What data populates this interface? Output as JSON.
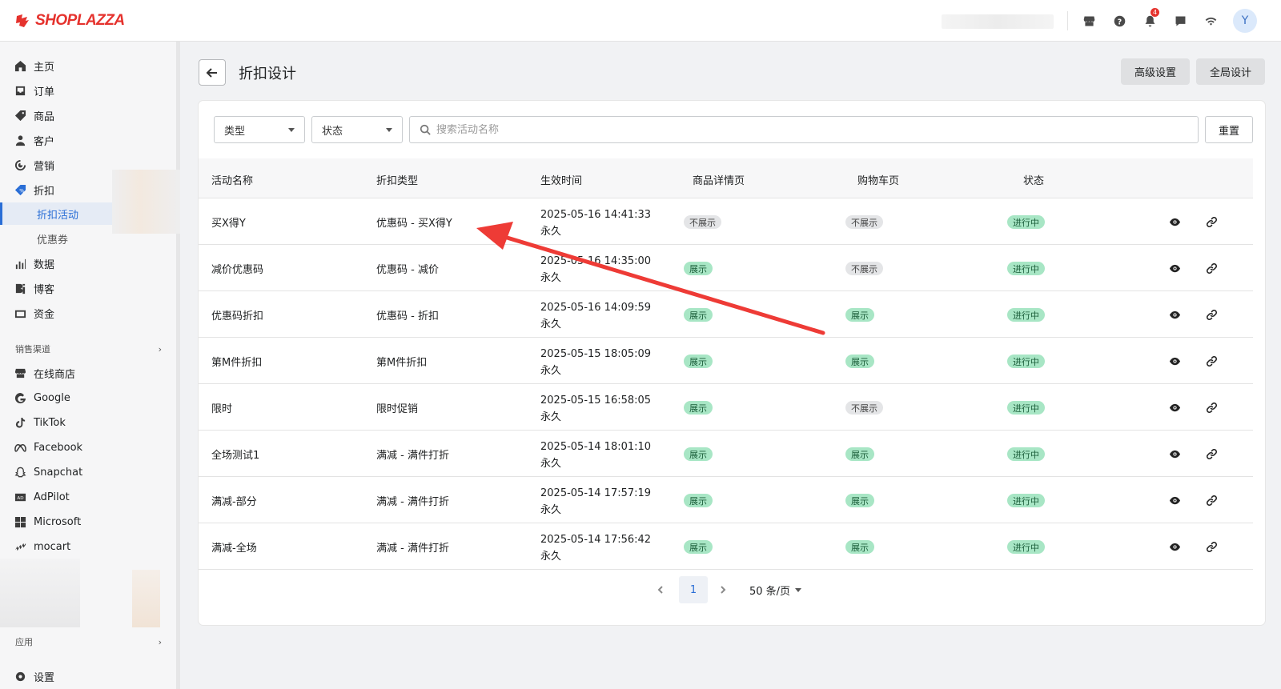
{
  "brand": {
    "logo_text": "SHOPLAZZA",
    "accent": "#e5322d"
  },
  "topbar": {
    "icons": [
      "store-icon",
      "help-icon",
      "bell-icon",
      "message-icon",
      "wifi-icon"
    ],
    "notification_count": "4",
    "avatar_initial": "Y"
  },
  "sidebar": {
    "items": [
      {
        "label": "主页",
        "icon": "home-icon"
      },
      {
        "label": "订单",
        "icon": "inbox-icon"
      },
      {
        "label": "商品",
        "icon": "tag-icon"
      },
      {
        "label": "客户",
        "icon": "person-icon"
      },
      {
        "label": "营销",
        "icon": "target-icon"
      },
      {
        "label": "折扣",
        "icon": "discount-icon"
      }
    ],
    "discount_sub": {
      "active": "折扣活动",
      "other": "优惠券"
    },
    "items2": [
      {
        "label": "数据",
        "icon": "bar-chart-icon"
      },
      {
        "label": "博客",
        "icon": "blog-icon"
      },
      {
        "label": "资金",
        "icon": "wallet-icon"
      }
    ],
    "sales_channel_title": "销售渠道",
    "channels": [
      {
        "label": "在线商店",
        "icon": "store-icon"
      },
      {
        "label": "Google",
        "icon": "google-icon"
      },
      {
        "label": "TikTok",
        "icon": "tiktok-icon"
      },
      {
        "label": "Facebook",
        "icon": "meta-icon"
      },
      {
        "label": "Snapchat",
        "icon": "snapchat-icon"
      },
      {
        "label": "AdPilot",
        "icon": "adpilot-icon"
      },
      {
        "label": "Microsoft",
        "icon": "microsoft-icon"
      },
      {
        "label": "mocart",
        "icon": "mocart-icon"
      }
    ],
    "apps_title": "应用",
    "settings_label": "设置"
  },
  "header": {
    "title": "折扣设计",
    "advanced_settings": "高级设置",
    "global_design": "全局设计"
  },
  "filters": {
    "type_label": "类型",
    "status_label": "状态",
    "search_placeholder": "搜索活动名称",
    "reset_label": "重置"
  },
  "table": {
    "columns": [
      "活动名称",
      "折扣类型",
      "生效时间",
      "商品详情页",
      "购物车页",
      "状态"
    ],
    "rows": [
      {
        "name": "买X得Y",
        "type": "优惠码 - 买X得Y",
        "start": "2025-05-16 14:41:33",
        "end": "永久",
        "detail": "不展示",
        "cart": "不展示",
        "status": "进行中"
      },
      {
        "name": "减价优惠码",
        "type": "优惠码 - 减价",
        "start": "2025-05-16 14:35:00",
        "end": "永久",
        "detail": "展示",
        "cart": "不展示",
        "status": "进行中"
      },
      {
        "name": "优惠码折扣",
        "type": "优惠码 - 折扣",
        "start": "2025-05-16 14:09:59",
        "end": "永久",
        "detail": "展示",
        "cart": "展示",
        "status": "进行中"
      },
      {
        "name": "第M件折扣",
        "type": "第M件折扣",
        "start": "2025-05-15 18:05:09",
        "end": "永久",
        "detail": "展示",
        "cart": "展示",
        "status": "进行中"
      },
      {
        "name": "限时",
        "type": "限时促销",
        "start": "2025-05-15 16:58:05",
        "end": "永久",
        "detail": "展示",
        "cart": "不展示",
        "status": "进行中"
      },
      {
        "name": "全场测试1",
        "type": "满减 - 满件打折",
        "start": "2025-05-14 18:01:10",
        "end": "永久",
        "detail": "展示",
        "cart": "展示",
        "status": "进行中"
      },
      {
        "name": "满减-部分",
        "type": "满减 - 满件打折",
        "start": "2025-05-14 17:57:19",
        "end": "永久",
        "detail": "展示",
        "cart": "展示",
        "status": "进行中"
      },
      {
        "name": "满减-全场",
        "type": "满减 - 满件打折",
        "start": "2025-05-14 17:56:42",
        "end": "永久",
        "detail": "展示",
        "cart": "展示",
        "status": "进行中"
      }
    ]
  },
  "pagination": {
    "current_page": "1",
    "page_size": "50 条/页"
  }
}
